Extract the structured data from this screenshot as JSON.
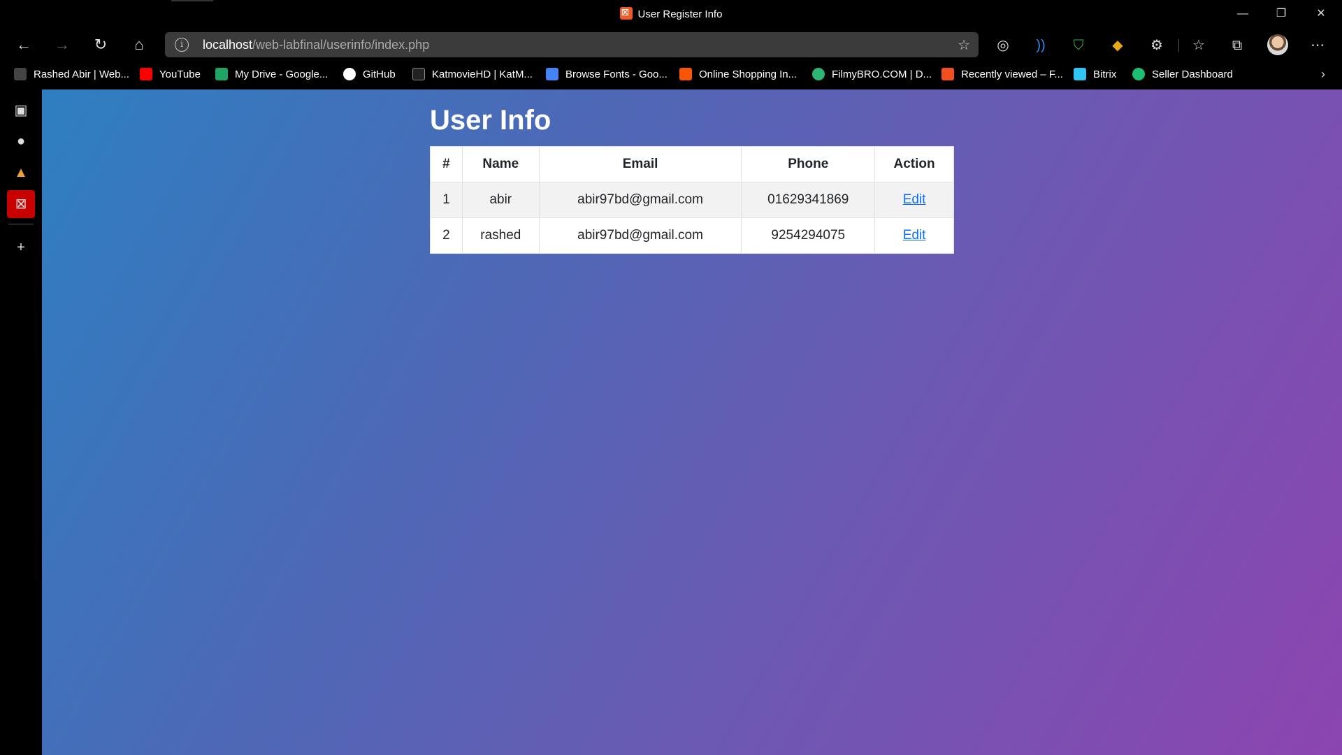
{
  "window": {
    "title": "User Register Info",
    "controls": {
      "minimize": "—",
      "restore": "❐",
      "close": "✕"
    }
  },
  "toolbar": {
    "url_host": "localhost",
    "url_path": "/web-labfinal/userinfo/index.php"
  },
  "bookmarks": [
    {
      "label": "Rashed Abir | Web...",
      "icon": "rashed-abir-icon",
      "color": "#444444"
    },
    {
      "label": "YouTube",
      "icon": "youtube-icon",
      "color": "#ff0000"
    },
    {
      "label": "My Drive - Google...",
      "icon": "google-drive-icon",
      "color": "#1fa463"
    },
    {
      "label": "GitHub",
      "icon": "github-icon",
      "color": "#ffffff"
    },
    {
      "label": "KatmovieHD | KatM...",
      "icon": "katmoviehd-icon",
      "color": "#222222"
    },
    {
      "label": "Browse Fonts - Goo...",
      "icon": "google-fonts-icon",
      "color": "#4285f4"
    },
    {
      "label": "Online Shopping In...",
      "icon": "daraz-icon",
      "color": "#f85606"
    },
    {
      "label": "FilmyBRO.COM | D...",
      "icon": "filmybro-icon",
      "color": "#2bb673"
    },
    {
      "label": "Recently viewed – F...",
      "icon": "figma-icon",
      "color": "#f24e1e"
    },
    {
      "label": "Bitrix",
      "icon": "bitrix-icon",
      "color": "#2fc6f6"
    },
    {
      "label": "Seller Dashboard",
      "icon": "fiverr-icon",
      "color": "#1dbf73"
    }
  ],
  "page": {
    "title": "User Info",
    "table": {
      "headers": [
        "#",
        "Name",
        "Email",
        "Phone",
        "Action"
      ],
      "rows": [
        {
          "id": "1",
          "name": "abir",
          "email": "abir97bd@gmail.com",
          "phone": "01629341869",
          "action": "Edit"
        },
        {
          "id": "2",
          "name": "rashed",
          "email": "abir97bd@gmail.com",
          "phone": "9254294075",
          "action": "Edit"
        }
      ]
    }
  },
  "colors": {
    "gradient_start": "#2e7fc1",
    "gradient_end": "#8c45b0",
    "link": "#0d6efd",
    "sidebar_active": "#c80000"
  }
}
